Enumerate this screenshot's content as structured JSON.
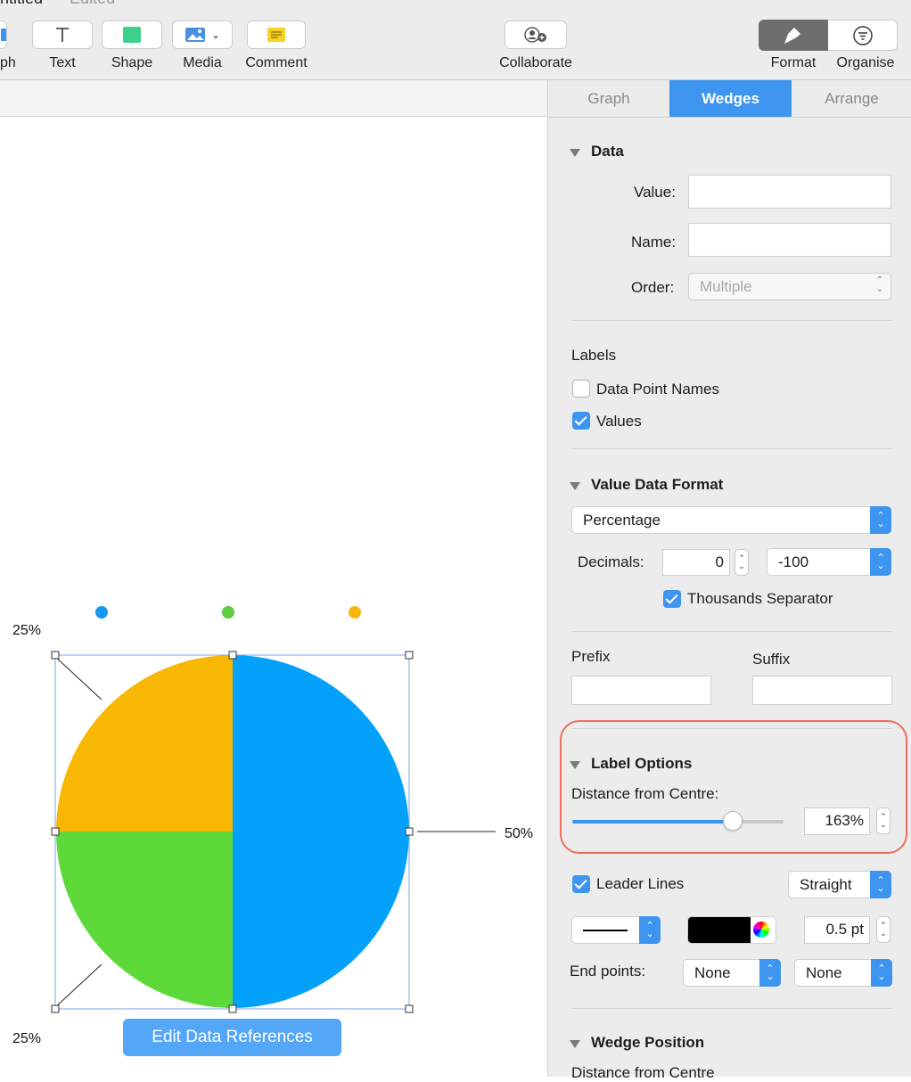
{
  "window": {
    "title_partial": "ntitled",
    "status_partial": "Edited"
  },
  "toolbar": {
    "partial_label": "ph",
    "text_label": "Text",
    "shape_label": "Shape",
    "media_label": "Media",
    "comment_label": "Comment",
    "collaborate_label": "Collaborate",
    "format_label": "Format",
    "organise_label": "Organise"
  },
  "inspector": {
    "tabs": [
      {
        "label": "Graph",
        "active": false
      },
      {
        "label": "Wedges",
        "active": true
      },
      {
        "label": "Arrange",
        "active": false
      }
    ],
    "data": {
      "heading": "Data",
      "value_label": "Value:",
      "value": "",
      "name_label": "Name:",
      "name": "",
      "order_label": "Order:",
      "order_value": "Multiple"
    },
    "labels": {
      "heading": "Labels",
      "data_point_names": {
        "label": "Data Point Names",
        "checked": false
      },
      "values": {
        "label": "Values",
        "checked": true
      }
    },
    "value_format": {
      "heading": "Value Data Format",
      "format": "Percentage",
      "decimals_label": "Decimals:",
      "decimals": "0",
      "negative": "-100",
      "thousands": {
        "label": "Thousands Separator",
        "checked": true
      }
    },
    "affix": {
      "prefix_label": "Prefix",
      "suffix_label": "Suffix",
      "prefix": "",
      "suffix": ""
    },
    "label_options": {
      "heading": "Label Options",
      "distance_label": "Distance from Centre:",
      "distance_value": "163%",
      "slider_fraction": 0.76
    },
    "leader": {
      "label": "Leader Lines",
      "checked": true,
      "style": "Straight",
      "width": "0.5 pt",
      "color": "#000000",
      "endpoints_label": "End points:",
      "end_start": "None",
      "end_end": "None"
    },
    "wedge_position": {
      "heading": "Wedge Position",
      "distance_partial": "Distance from Centre"
    }
  },
  "canvas": {
    "edit_button": "Edit Data References"
  },
  "chart_data": {
    "type": "pie",
    "slices": [
      {
        "value": 50,
        "label": "50%",
        "color": "#04a1fb"
      },
      {
        "value": 25,
        "label": "25%",
        "color": "#5ed93a"
      },
      {
        "value": 25,
        "label": "25%",
        "color": "#f8b703"
      }
    ],
    "legend_colors": [
      "#1799ef",
      "#5ecb40",
      "#f8b50d"
    ]
  }
}
